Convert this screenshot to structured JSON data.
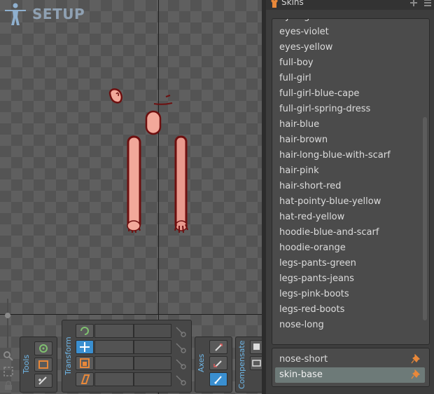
{
  "viewport": {
    "mode_label": "SETUP",
    "icons": [
      "figure-icon",
      "zoom-icon",
      "fit-icon",
      "lock-icon"
    ]
  },
  "panel": {
    "title": "Skins",
    "skins": [
      "eyes-green",
      "eyes-violet",
      "eyes-yellow",
      "full-boy",
      "full-girl",
      "full-girl-blue-cape",
      "full-girl-spring-dress",
      "hair-blue",
      "hair-brown",
      "hair-long-blue-with-scarf",
      "hair-pink",
      "hair-short-red",
      "hat-pointy-blue-yellow",
      "hat-red-yellow",
      "hoodie-blue-and-scarf",
      "hoodie-orange",
      "legs-pants-green",
      "legs-pants-jeans",
      "legs-pink-boots",
      "legs-red-boots",
      "nose-long"
    ],
    "active_skins": [
      "nose-short",
      "skin-base"
    ],
    "selected_active": "skin-base"
  },
  "toolbar": {
    "tools_label": "Tools",
    "transform_label": "Transform",
    "axes_label": "Axes",
    "compensate_label": "Compensate"
  },
  "colors": {
    "accent": "#3a8fd0",
    "skin_fill": "#f2a89a",
    "skin_outline": "#6e0f0f",
    "label_blue": "#6fb6e6"
  }
}
